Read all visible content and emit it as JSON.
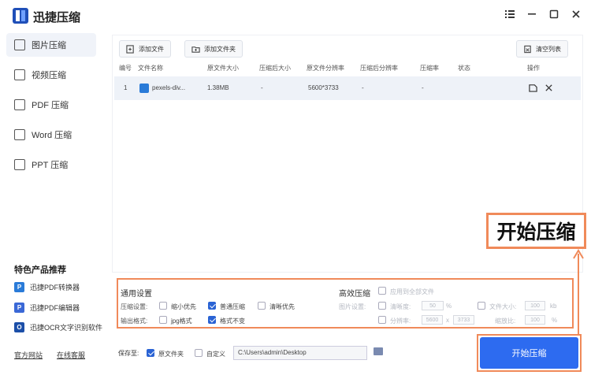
{
  "app": {
    "title": "迅捷压缩"
  },
  "sidebar": {
    "items": [
      {
        "label": "图片压缩"
      },
      {
        "label": "视频压缩"
      },
      {
        "label": "PDF 压缩"
      },
      {
        "label": "Word 压缩"
      },
      {
        "label": "PPT 压缩"
      }
    ],
    "featured_title": "特色产品推荐",
    "featured": [
      {
        "label": "迅捷PDF转换器",
        "badge": "P"
      },
      {
        "label": "迅捷PDF编辑器",
        "badge": "P"
      },
      {
        "label": "迅捷OCR文字识别软件",
        "badge": "O"
      }
    ],
    "links": [
      "官方网站",
      "在线客服"
    ]
  },
  "toolbar": {
    "add_file": "添加文件",
    "add_folder": "添加文件夹",
    "clear_list": "清空列表"
  },
  "table": {
    "columns": [
      "编号",
      "文件名称",
      "原文件大小",
      "压缩后大小",
      "原文件分辨率",
      "压缩后分辨率",
      "压缩率",
      "状态",
      "操作"
    ],
    "rows": [
      {
        "index": "1",
        "name": "pexels-div...",
        "size": "1.38MB",
        "compressed_size": "-",
        "resolution": "5600*3733",
        "compressed_resolution": "-",
        "ratio": "-"
      }
    ]
  },
  "settings": {
    "general_title": "通用设置",
    "compress_label": "压缩设置:",
    "output_label": "输出格式:",
    "options": {
      "small": "缩小优先",
      "normal": "普通压缩",
      "clear": "清晰优先",
      "jpg": "jpg格式",
      "keep": "格式不变"
    },
    "advanced_title": "高效压缩",
    "apply_all": "应用到全部文件",
    "image_label": "图片设置:",
    "clarity": "清晰度:",
    "clarity_value": "50",
    "percent": "%",
    "file_size": "文件大小:",
    "file_size_value": "100",
    "kb": "kb",
    "resolution": "分辨率:",
    "res_w": "5600",
    "res_x": "x",
    "res_h": "3733",
    "scale": "缩放比:",
    "scale_value": "100"
  },
  "bottom": {
    "save_to": "保存至:",
    "original_folder": "原文件夹",
    "custom": "自定义",
    "path": "C:\\Users\\admin\\Desktop",
    "start": "开始压缩"
  },
  "callout": {
    "text": "开始压缩"
  },
  "colors": {
    "accent": "#2d6bf0",
    "highlight": "#f08a5a"
  }
}
